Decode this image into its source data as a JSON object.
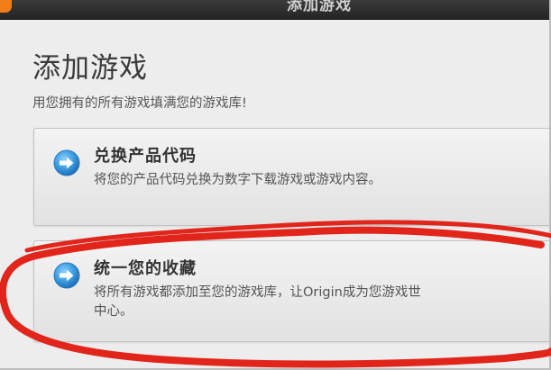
{
  "window": {
    "title": "添加游戏"
  },
  "header": {
    "title": "添加游戏",
    "subtitle": "用您拥有的所有游戏填满您的游戏库!"
  },
  "options": [
    {
      "title": "兑换产品代码",
      "description": "将您的产品代码兑换为数字下载游戏或游戏内容。",
      "icon": "arrow-right-circle-icon"
    },
    {
      "title": "统一您的收藏",
      "description": "将所有游戏都添加至您的游戏库，让Origin成为您游戏世\n中心。",
      "icon": "arrow-right-circle-icon"
    }
  ],
  "colors": {
    "accent_blue": "#3a9be0",
    "annotation_red": "#e1251b",
    "brand_orange": "#f07d16"
  }
}
